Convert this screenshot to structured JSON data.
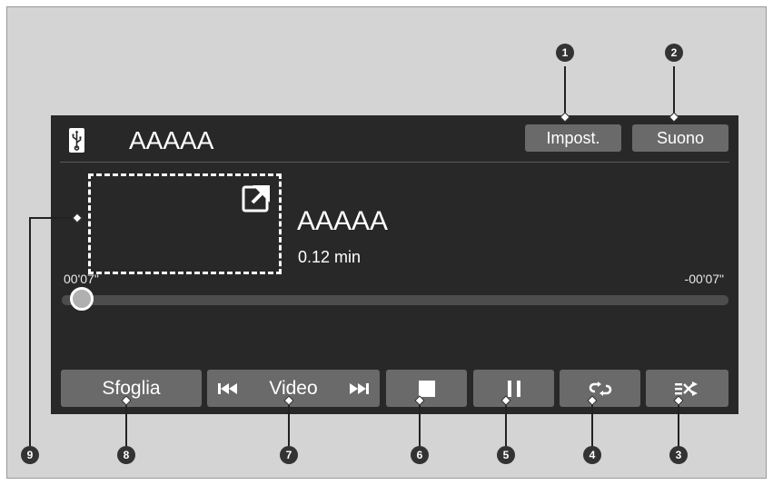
{
  "header": {
    "source_icon": "usb-icon",
    "title": "AAAAA",
    "settings_label": "Impost.",
    "sound_label": "Suono"
  },
  "now_playing": {
    "album_art_icon": "external-link-icon",
    "track_title": "AAAAA",
    "track_length": "0.12 min",
    "elapsed": "00'07\"",
    "remaining": "-00'07\"",
    "progress_fraction": 0.02
  },
  "controls": {
    "browse_label": "Sfoglia",
    "video_label": "Video",
    "prev_icon": "skip-previous-icon",
    "next_icon": "skip-next-icon",
    "stop_icon": "stop-icon",
    "pause_icon": "pause-icon",
    "repeat_icon": "repeat-icon",
    "shuffle_icon": "shuffle-icon"
  },
  "callouts": [
    "1",
    "2",
    "3",
    "4",
    "5",
    "6",
    "7",
    "8",
    "9"
  ],
  "colors": {
    "screen_bg": "#282828",
    "button_bg": "#6a6a6a",
    "frame_bg": "#d4d4d4",
    "text": "#ffffff"
  }
}
